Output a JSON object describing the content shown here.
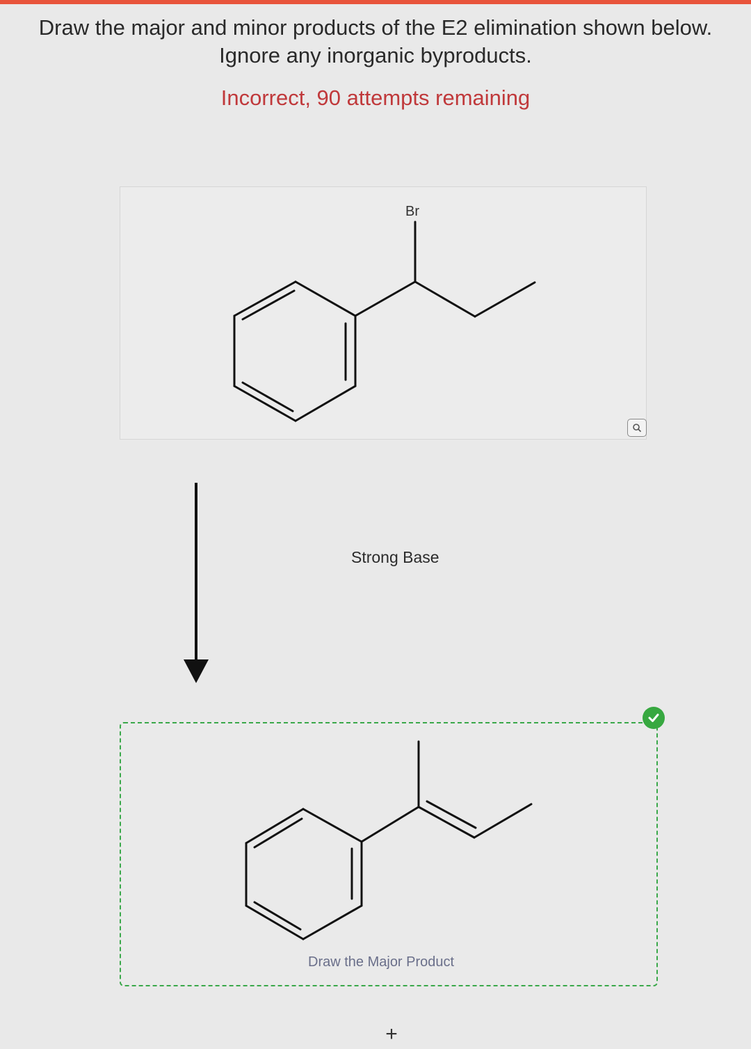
{
  "question": {
    "line1": "Draw the major and minor products of the E2 elimination shown below.",
    "line2": "Ignore any inorganic byproducts."
  },
  "feedback": "Incorrect, 90 attempts remaining",
  "reactant": {
    "substituent_label": "Br",
    "zoom_icon": "magnifier-icon"
  },
  "reaction": {
    "condition": "Strong Base",
    "arrow_icon": "down-arrow-icon"
  },
  "product_box": {
    "label": "Draw the Major Product",
    "status_icon": "checkmark-icon",
    "status_color": "#37a840",
    "border_color": "#3aa84a"
  },
  "add_button": {
    "label": "+"
  },
  "colors": {
    "accent_bar": "#e8543b",
    "feedback_text": "#c0393b",
    "draw_label": "#6a6f8a"
  }
}
